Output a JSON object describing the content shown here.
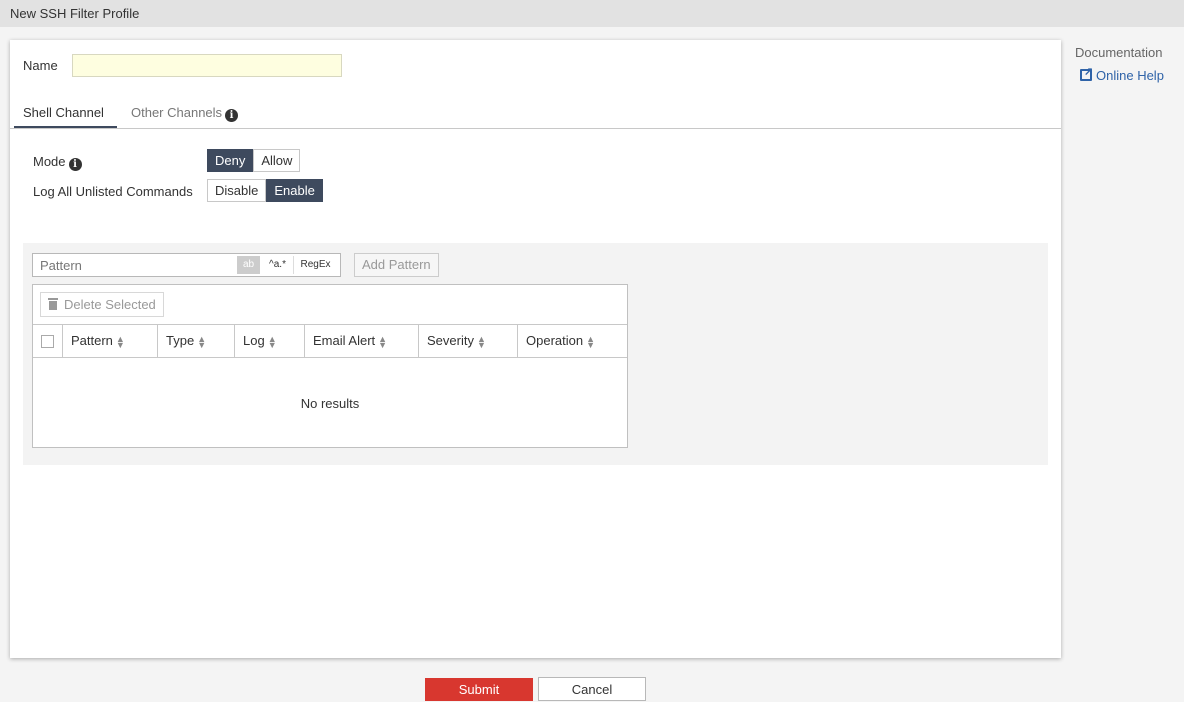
{
  "window": {
    "title": "New SSH Filter Profile"
  },
  "form": {
    "name_label": "Name",
    "name_value": "",
    "tabs": [
      {
        "label": "Shell Channel",
        "active": true
      },
      {
        "label": "Other Channels",
        "active": false,
        "icon": "info-icon"
      }
    ],
    "mode": {
      "label": "Mode",
      "options": [
        "Deny",
        "Allow"
      ],
      "selected": "Deny"
    },
    "log_unlisted": {
      "label": "Log All Unlisted Commands",
      "options": [
        "Disable",
        "Enable"
      ],
      "selected": "Enable"
    }
  },
  "patterns": {
    "input_placeholder": "Pattern",
    "match_types": [
      "ab",
      "^a.*",
      "RegEx"
    ],
    "add_label": "Add Pattern",
    "delete_label": "Delete Selected",
    "columns": [
      "Pattern",
      "Type",
      "Log",
      "Email Alert",
      "Severity",
      "Operation"
    ],
    "rows": [],
    "empty_text": "No results"
  },
  "sidebar": {
    "title": "Documentation",
    "help_label": "Online Help"
  },
  "footer": {
    "submit_label": "Submit",
    "cancel_label": "Cancel"
  },
  "colors": {
    "toggle_active": "#3e4a5e",
    "submit": "#d8372f",
    "link": "#2f63a8",
    "name_input_bg": "#fefee0"
  }
}
